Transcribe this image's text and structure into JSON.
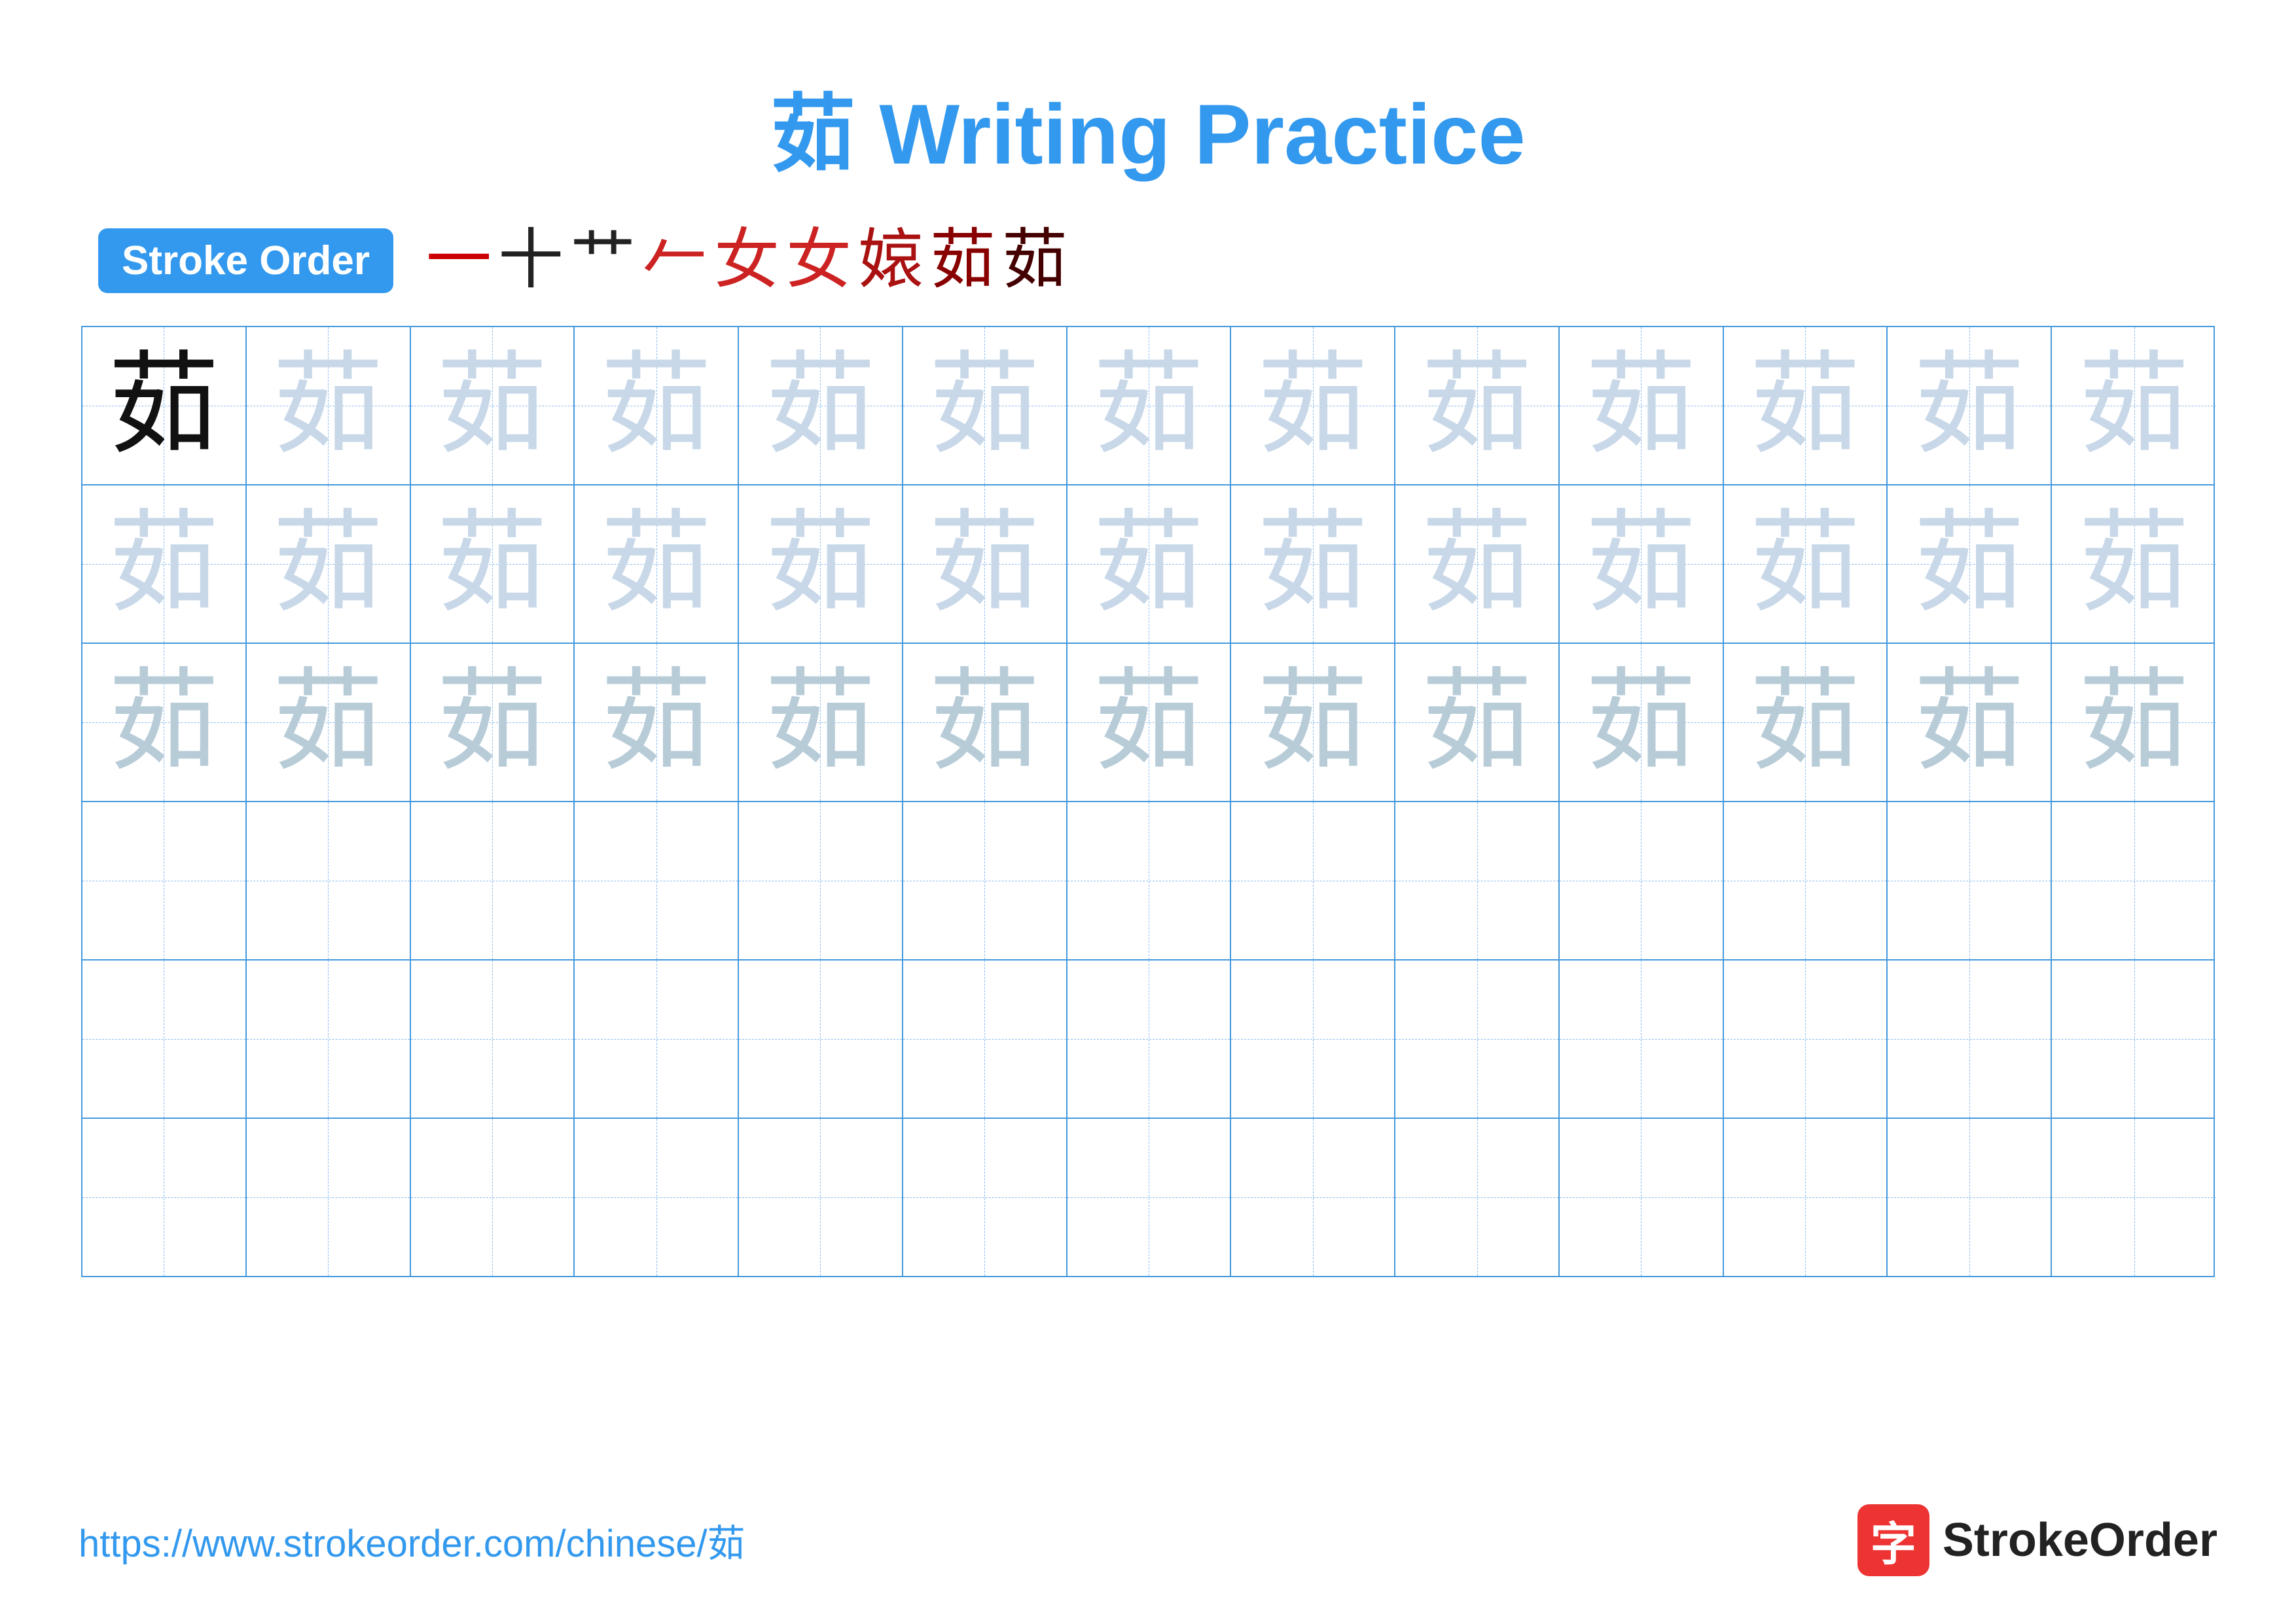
{
  "title": {
    "chinese_char": "茹",
    "rest": " Writing Practice",
    "full": "茹 Writing Practice"
  },
  "stroke_order": {
    "badge_label": "Stroke Order",
    "strokes": [
      "一",
      "十",
      "艹",
      "𠂉",
      "女",
      "女",
      "𡟓",
      "茹",
      "茹"
    ]
  },
  "grid": {
    "rows": 6,
    "cols": 13,
    "character": "茹",
    "row_styles": [
      "dark_then_light1",
      "light1",
      "light2",
      "empty",
      "empty",
      "empty"
    ]
  },
  "footer": {
    "url": "https://www.strokeorder.com/chinese/茹",
    "logo_icon_char": "字",
    "logo_text": "StrokeOrder"
  }
}
